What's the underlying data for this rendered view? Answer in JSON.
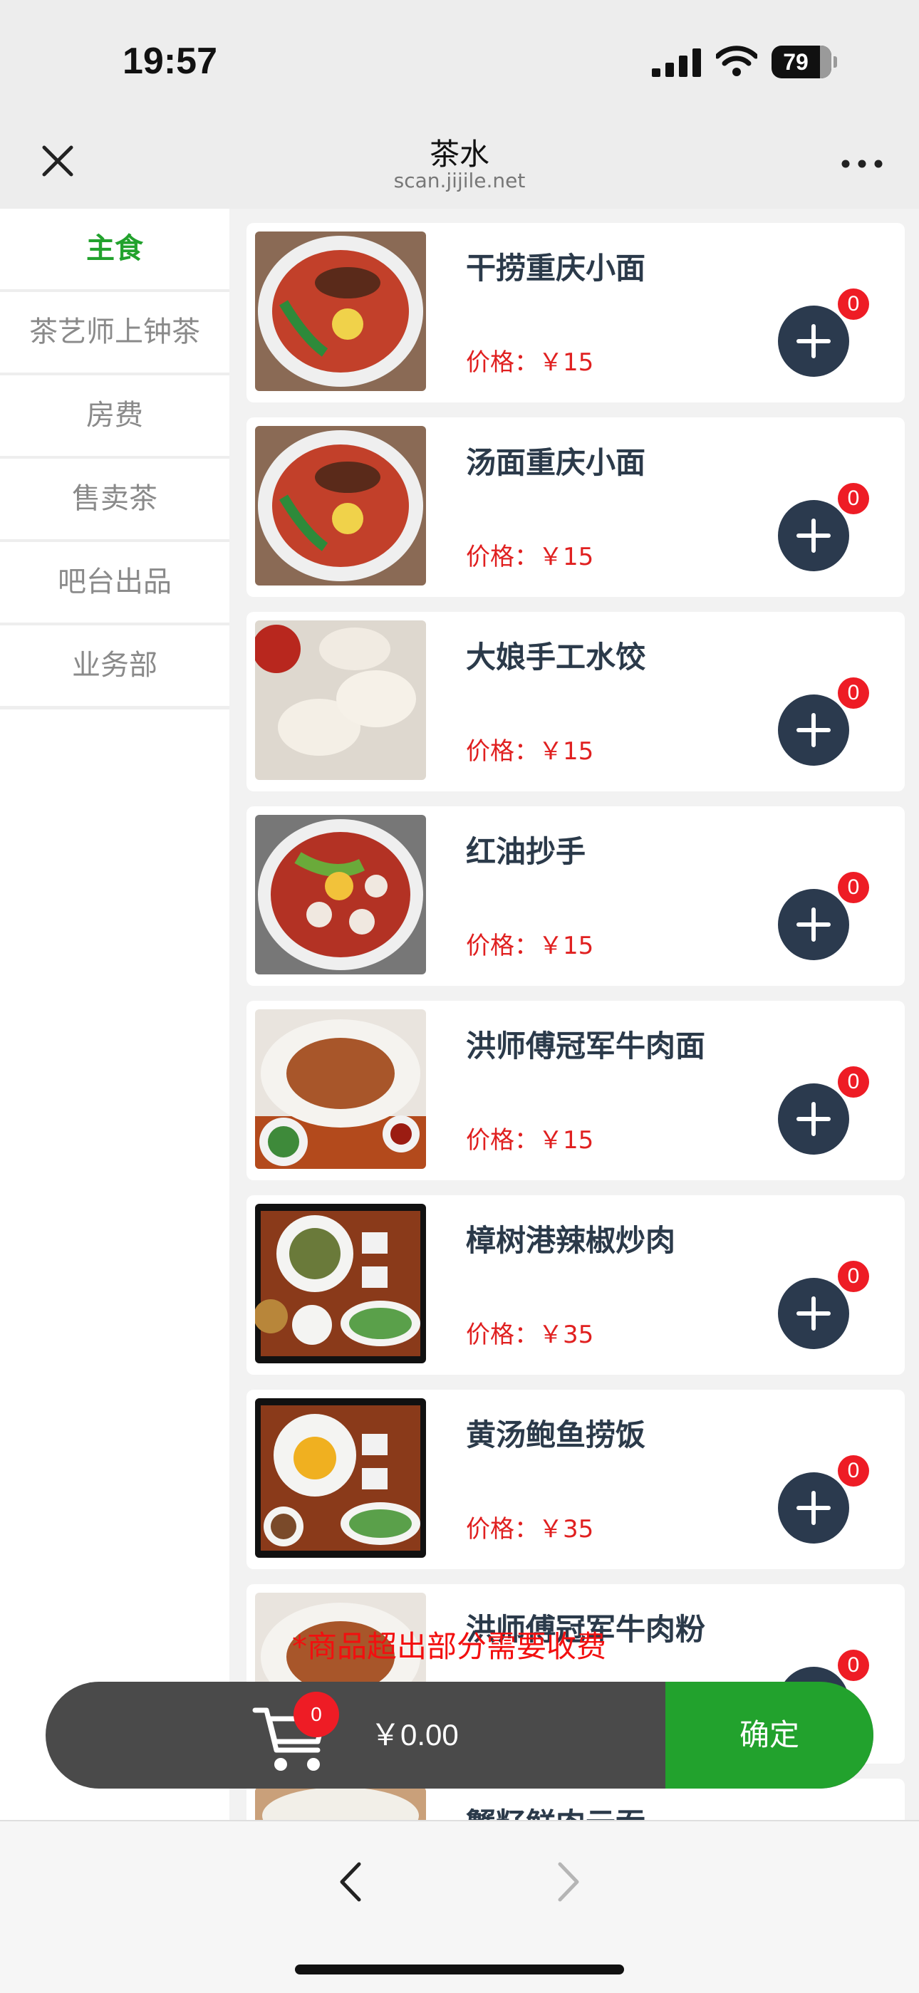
{
  "status": {
    "time": "19:57",
    "battery": "79"
  },
  "header": {
    "title": "茶水",
    "url": "scan.jijile.net"
  },
  "sidebar": {
    "items": [
      {
        "label": "主食",
        "active": true
      },
      {
        "label": "茶艺师上钟茶",
        "active": false
      },
      {
        "label": "房费",
        "active": false
      },
      {
        "label": "售卖茶",
        "active": false
      },
      {
        "label": "吧台出品",
        "active": false
      },
      {
        "label": "业务部",
        "active": false
      }
    ]
  },
  "products": {
    "items": [
      {
        "name": "干捞重庆小面",
        "price_text": "价格：￥15",
        "quantity": "0"
      },
      {
        "name": "汤面重庆小面",
        "price_text": "价格：￥15",
        "quantity": "0"
      },
      {
        "name": "大娘手工水饺",
        "price_text": "价格：￥15",
        "quantity": "0"
      },
      {
        "name": "红油抄手",
        "price_text": "价格：￥15",
        "quantity": "0"
      },
      {
        "name": "洪师傅冠军牛肉面",
        "price_text": "价格：￥15",
        "quantity": "0"
      },
      {
        "name": "樟树港辣椒炒肉",
        "price_text": "价格：￥35",
        "quantity": "0"
      },
      {
        "name": "黄汤鲍鱼捞饭",
        "price_text": "价格：￥35",
        "quantity": "0"
      },
      {
        "name": "洪师傅冠军牛肉粉",
        "price_text": "",
        "quantity": "0"
      },
      {
        "name": "蟹籽鲜肉云吞",
        "price_text": "",
        "quantity": ""
      }
    ]
  },
  "notice": "*商品超出部分需要收费",
  "cart": {
    "count": "0",
    "total": "￥0.00",
    "confirm_label": "确定"
  },
  "icons": {
    "close": "close-icon",
    "more": "more-icon",
    "cart": "cart-icon",
    "add": "plus-icon",
    "back": "chevron-left-icon",
    "forward": "chevron-right-icon"
  },
  "colors": {
    "accent_green": "#22a22d",
    "price_red": "#e02020",
    "add_button": "#2b3a4e",
    "badge_red": "#ee1c25"
  }
}
